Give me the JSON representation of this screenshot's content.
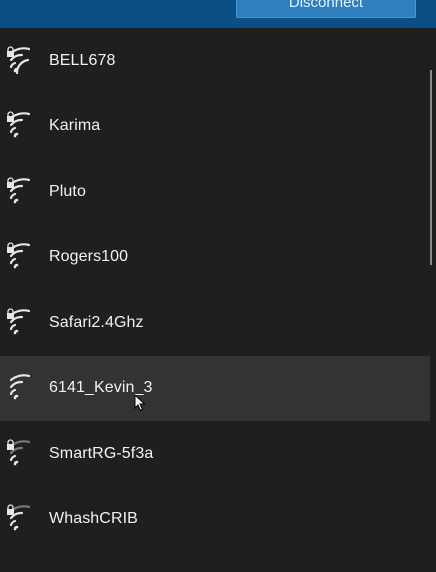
{
  "header": {
    "disconnect_label": "Disconnect"
  },
  "networks": [
    {
      "name": "BELL678",
      "secured": true,
      "icon": "wifi-signal-icon"
    },
    {
      "name": "Karima",
      "secured": true,
      "icon": "wifi-signal-icon"
    },
    {
      "name": "Pluto",
      "secured": true,
      "icon": "wifi-signal-icon"
    },
    {
      "name": "Rogers100",
      "secured": true,
      "icon": "wifi-signal-icon"
    },
    {
      "name": "Safari2.4Ghz",
      "secured": true,
      "icon": "wifi-signal-icon"
    },
    {
      "name": "6141_Kevin_3",
      "secured": false,
      "icon": "wifi-signal-icon"
    },
    {
      "name": "SmartRG-5f3a",
      "secured": true,
      "icon": "wifi-signal-icon"
    },
    {
      "name": "WhashCRIB",
      "secured": true,
      "icon": "wifi-signal-icon"
    }
  ],
  "colors": {
    "background": "#1f1f1f",
    "accent": "#0b4f86",
    "hover": "#333333",
    "text": "#f2f2f2"
  }
}
